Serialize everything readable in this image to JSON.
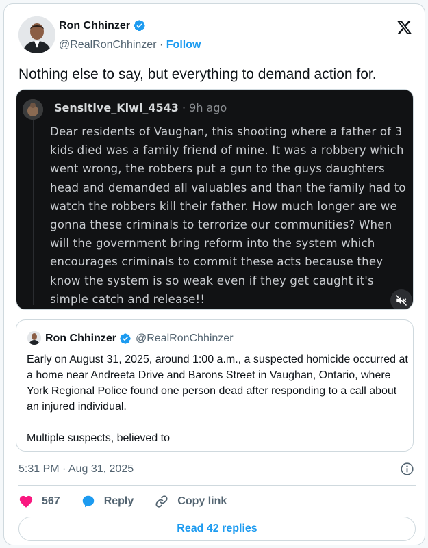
{
  "author": {
    "name": "Ron Chhinzer",
    "handle": "@RealRonChhinzer",
    "separator": "·",
    "follow_label": "Follow"
  },
  "tweet": {
    "text": "Nothing else to say, but everything to demand action for."
  },
  "media": {
    "reddit_user": "Sensitive_Kiwi_4543",
    "separator": "·",
    "time_ago": "9h ago",
    "body": "Dear residents of Vaughan, this shooting where a father of 3 kids died was a family friend of mine. It was a robbery which went wrong, the robbers put a gun to the guys daughters head and demanded all valuables and than the family had to watch the robbers kill their father. How much longer are we gonna these criminals to terrorize our communities? When will the government bring reform into the system which encourages criminals to commit these acts because they know the system is so weak even if they get caught it's simple catch and release!!",
    "mute_icon": "speaker-muted-icon"
  },
  "quote": {
    "name": "Ron Chhinzer",
    "handle": "@RealRonChhinzer",
    "body": "Early on August 31, 2025, around 1:00 a.m., a suspected homicide occurred at a home near Andreeta Drive and Barons Street in Vaughan, Ontario, where York Regional Police found one person dead after responding to a call about an injured individual.\n\nMultiple suspects, believed to"
  },
  "meta": {
    "timestamp": "5:31 PM · Aug 31, 2025"
  },
  "actions": {
    "like_count": "567",
    "reply_label": "Reply",
    "copy_label": "Copy link"
  },
  "footer": {
    "read_replies_label": "Read 42 replies"
  },
  "colors": {
    "accent": "#1d9bf0",
    "like": "#f91880",
    "text": "#0f1419",
    "muted": "#536471"
  }
}
